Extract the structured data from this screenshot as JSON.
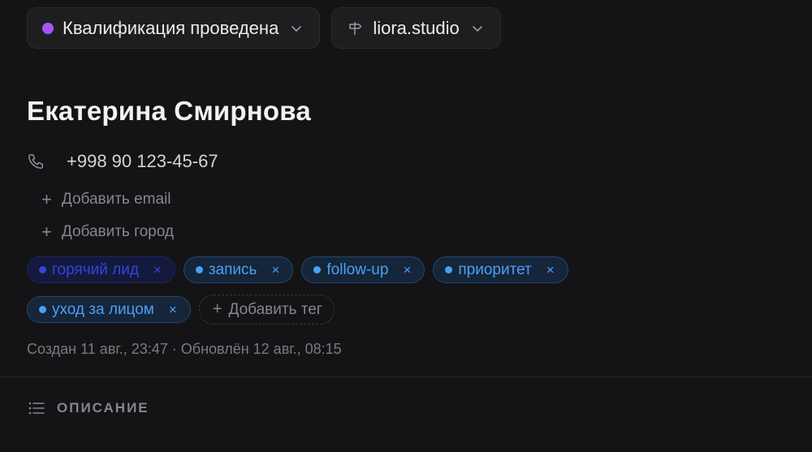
{
  "header": {
    "status": {
      "label": "Квалификация проведена",
      "dot_color": "#a855f7"
    },
    "source": {
      "label": "liora.studio"
    }
  },
  "contact": {
    "name": "Екатерина Смирнова",
    "phone": "+998 90 123-45-67",
    "add_email_label": "Добавить email",
    "add_city_label": "Добавить город"
  },
  "tags": {
    "items": [
      {
        "label": "горячий лид",
        "remove": "×"
      },
      {
        "label": "запись",
        "remove": "×"
      },
      {
        "label": "follow-up",
        "remove": "×"
      },
      {
        "label": "приоритет",
        "remove": "×"
      },
      {
        "label": "уход за лицом",
        "remove": "×"
      }
    ],
    "add_label": "Добавить тег"
  },
  "meta": {
    "text": "Создан 11 авг., 23:47 · Обновлён 12 авг., 08:15"
  },
  "sections": {
    "description_label": "ОПИСАНИЕ"
  },
  "icons": {
    "status_chevron": "chevron-down-icon",
    "source_icon": "signpost-icon",
    "phone": "phone-icon",
    "description": "list-icon"
  },
  "colors": {
    "background": "#141416",
    "tag_accent": "#4aa0f2",
    "tag_hot": "#2f47d9",
    "status_dot": "#a855f7"
  }
}
